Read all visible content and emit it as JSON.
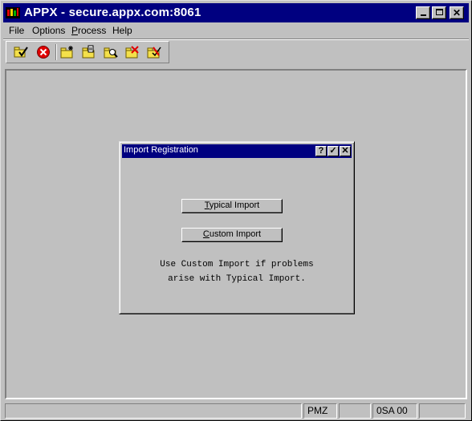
{
  "window": {
    "title": "APPX - secure.appx.com:8061"
  },
  "menubar": {
    "items": [
      {
        "label": "File",
        "underline": "F",
        "rest": "ile"
      },
      {
        "label": "Options",
        "underline": "O",
        "rest": "ptions"
      },
      {
        "label": "Process",
        "underline": "P",
        "rest": "rocess"
      },
      {
        "label": "Help",
        "underline": "H",
        "rest": "elp"
      }
    ]
  },
  "toolbar": {
    "buttons": [
      "check-folder-icon",
      "cancel-icon",
      "new-folder-icon",
      "edit-folder-icon",
      "search-folder-icon",
      "delete-folder-icon",
      "cancel-folder-icon"
    ]
  },
  "dialog": {
    "title": "Import Registration",
    "help_label": "?",
    "ok_label": "✓",
    "close_label": "✕",
    "typical_button": {
      "underline": "T",
      "rest": "ypical Import"
    },
    "custom_button": {
      "underline": "C",
      "rest": "ustom Import"
    },
    "message_line1": "Use Custom Import if problems",
    "message_line2": "arise with Typical Import."
  },
  "statusbar": {
    "panels": [
      "",
      "",
      "PMZ",
      "",
      "0SA 00",
      ""
    ]
  },
  "colors": {
    "titlebar": "#000080",
    "face": "#c0c0c0"
  }
}
